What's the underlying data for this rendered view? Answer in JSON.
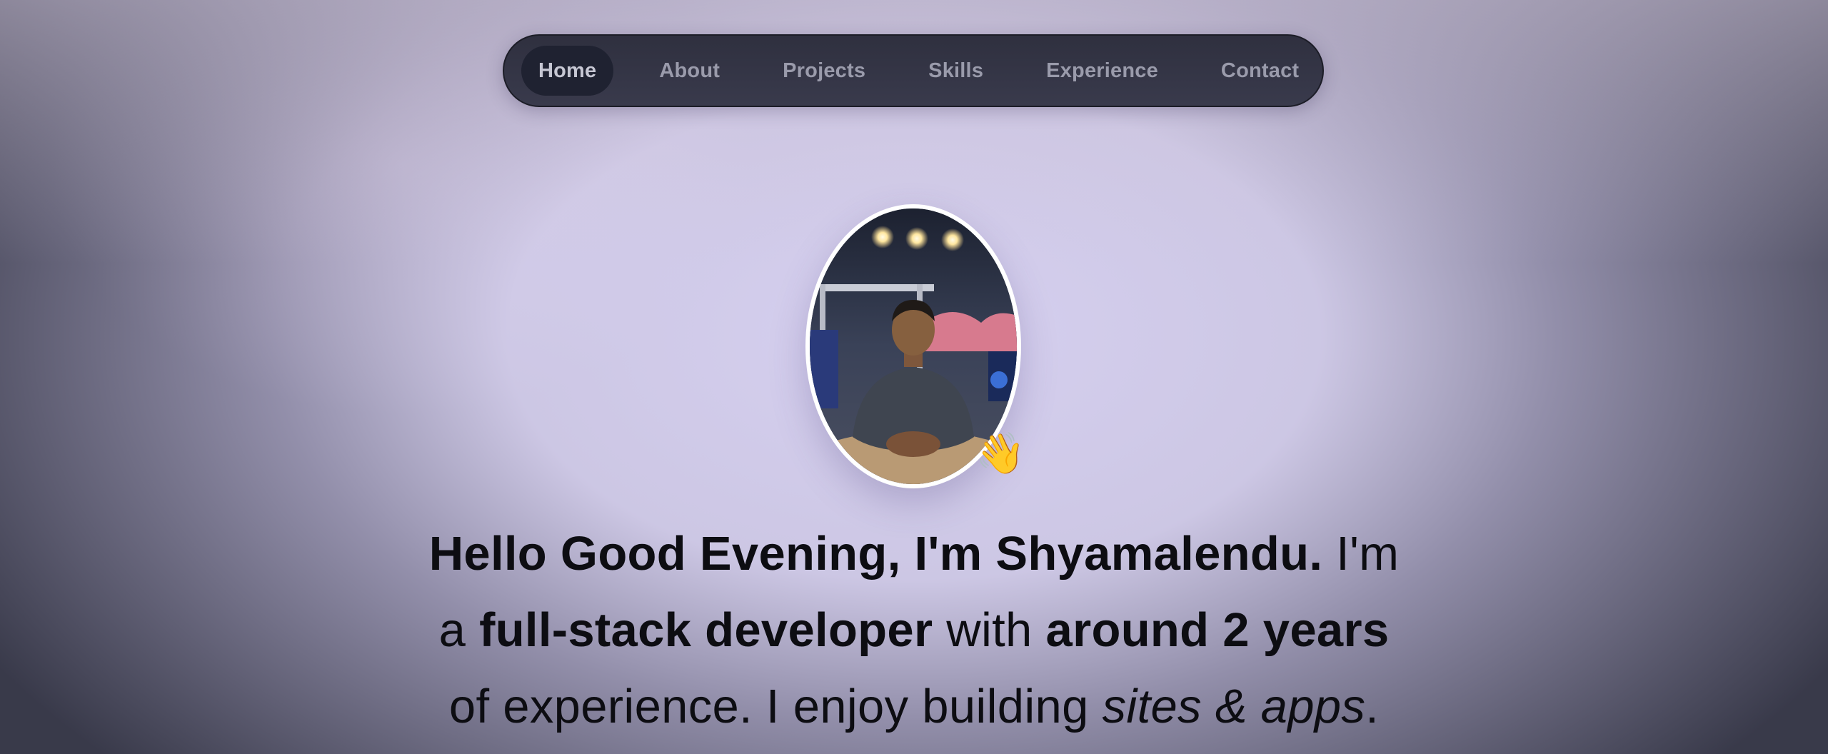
{
  "nav": {
    "items": [
      {
        "label": "Home",
        "active": true
      },
      {
        "label": "About",
        "active": false
      },
      {
        "label": "Projects",
        "active": false
      },
      {
        "label": "Skills",
        "active": false
      },
      {
        "label": "Experience",
        "active": false
      },
      {
        "label": "Contact",
        "active": false
      }
    ]
  },
  "hero": {
    "wave_emoji": "👋",
    "line1_bold": "Hello Good Evening, I'm Shyamalendu.",
    "line1_rest": " I'm",
    "line2_a": "a ",
    "line2_bold1": "full-stack developer",
    "line2_b": " with ",
    "line2_bold2": "around 2 years",
    "line3_a": "of experience. I enjoy building ",
    "line3_italic": "sites & apps",
    "line3_end": "."
  },
  "colors": {
    "nav_bg": "#33344a",
    "nav_active_bg": "#1f2231",
    "nav_text": "#9a9bab",
    "headline_text": "#0d0d12"
  }
}
